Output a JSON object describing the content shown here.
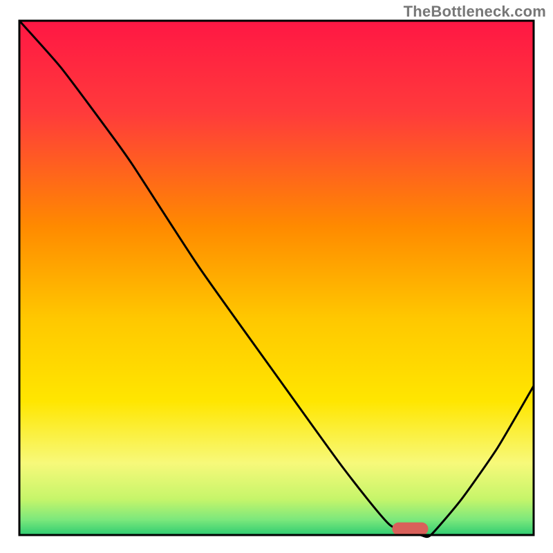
{
  "watermark": "TheBottleneck.com",
  "chart_data": {
    "type": "line",
    "title": "",
    "xlabel": "",
    "ylabel": "",
    "xlim": [
      0,
      100
    ],
    "ylim": [
      0,
      100
    ],
    "grid": false,
    "legend": false,
    "gradient_stops": [
      {
        "offset": 0,
        "color": "#ff1744"
      },
      {
        "offset": 18,
        "color": "#ff3b3b"
      },
      {
        "offset": 40,
        "color": "#ff8a00"
      },
      {
        "offset": 58,
        "color": "#ffc800"
      },
      {
        "offset": 74,
        "color": "#ffe600"
      },
      {
        "offset": 86,
        "color": "#f7f97a"
      },
      {
        "offset": 93,
        "color": "#c6f56a"
      },
      {
        "offset": 97,
        "color": "#7CE87C"
      },
      {
        "offset": 100,
        "color": "#2ecc71"
      }
    ],
    "series": [
      {
        "name": "bottleneck-curve",
        "x": [
          0,
          8,
          17,
          22,
          35,
          50,
          63,
          72,
          78,
          80,
          86,
          93,
          100
        ],
        "values": [
          100,
          91,
          79,
          72,
          52,
          31,
          13,
          2,
          0,
          0,
          7,
          17,
          29
        ]
      }
    ],
    "marker": {
      "x": 76,
      "y": 1.2,
      "color": "#d9605a",
      "width": 7,
      "height": 2.5
    },
    "frame": {
      "stroke": "#000000",
      "stroke_width": 3
    }
  }
}
